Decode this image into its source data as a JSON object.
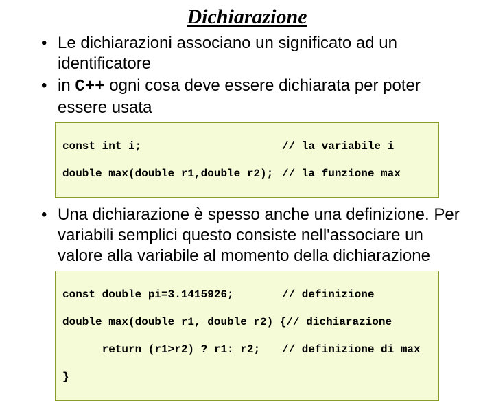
{
  "title": "Dichiarazione",
  "bullets": {
    "b1": "Le dichiarazioni associano un significato ad un identificatore",
    "b2_pre": "in ",
    "b2_kw": "C++",
    "b2_post": " ogni cosa deve essere dichiarata per poter essere usata",
    "b3": "Una dichiarazione è spesso anche una definizione. Per variabili semplici questo consiste nell'associare un valore alla variabile al momento della dichiarazione"
  },
  "code1": {
    "l1_left": "const int i;",
    "l1_right": "// la variabile i",
    "l2_left": "double max(double r1,double r2);",
    "l2_right": "// la funzione max"
  },
  "code2": {
    "l1_left": "const double pi=3.1415926;",
    "l1_right": "// definizione",
    "l2_left": "double max(double r1, double r2) {",
    "l2_right": "// dichiarazione",
    "l3_left": "      return (r1>r2) ? r1: r2;",
    "l3_right": "// definizione di max",
    "l4_left": "}",
    "l4_right": ""
  }
}
